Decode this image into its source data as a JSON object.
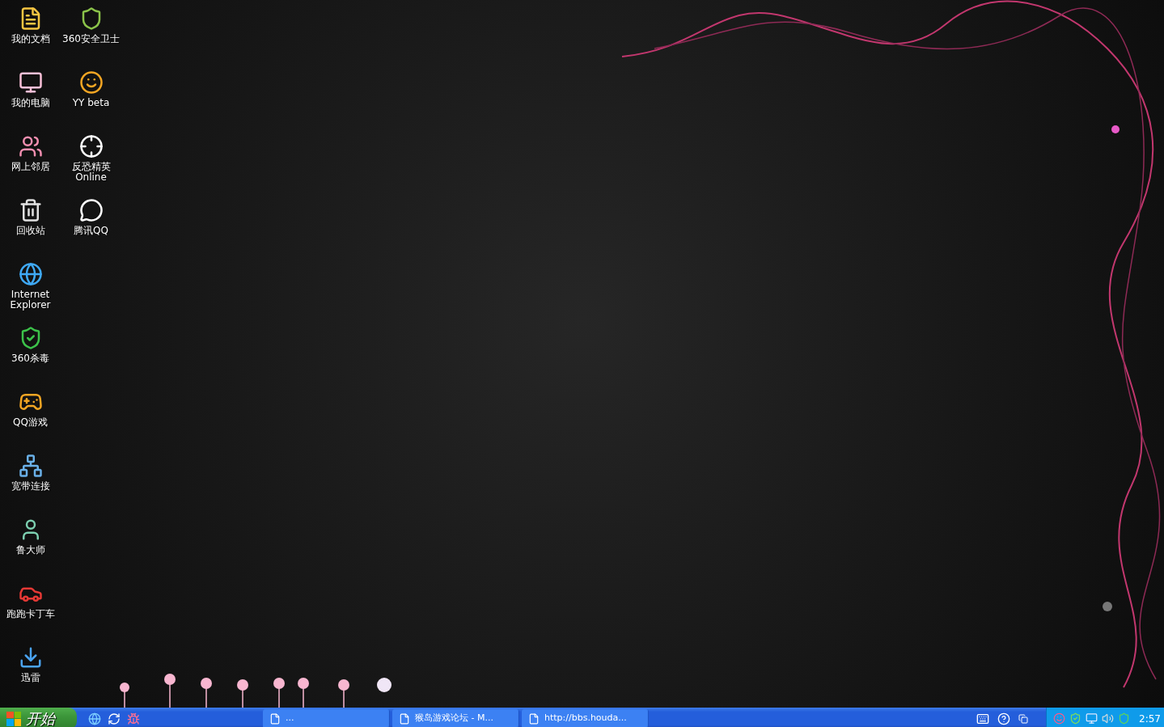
{
  "desktop_icons": [
    [
      {
        "label": "我的文档",
        "kind": "documents"
      },
      {
        "label": "我的电脑",
        "kind": "computer"
      },
      {
        "label": "网上邻居",
        "kind": "network"
      },
      {
        "label": "回收站",
        "kind": "recycle"
      },
      {
        "label": "Internet Explorer",
        "kind": "browser"
      },
      {
        "label": "360杀毒",
        "kind": "antivirus"
      },
      {
        "label": "QQ游戏",
        "kind": "game"
      },
      {
        "label": "宽带连接",
        "kind": "connection"
      },
      {
        "label": "鲁大师",
        "kind": "tool"
      },
      {
        "label": "跑跑卡丁车",
        "kind": "racing"
      },
      {
        "label": "迅雷",
        "kind": "download"
      }
    ],
    [
      {
        "label": "360安全卫士",
        "kind": "security"
      },
      {
        "label": "YY beta",
        "kind": "chat"
      },
      {
        "label": "反恐精英 Online",
        "kind": "shooter"
      },
      {
        "label": "腾讯QQ",
        "kind": "messenger"
      }
    ]
  ],
  "taskbar": {
    "start_label": "开始",
    "windows": [
      {
        "title": "...",
        "selected": false
      },
      {
        "title": "猴岛游戏论坛 - M...",
        "selected": false
      },
      {
        "title": "http://bbs.houda...",
        "selected": false
      }
    ],
    "clock": "2:57"
  }
}
